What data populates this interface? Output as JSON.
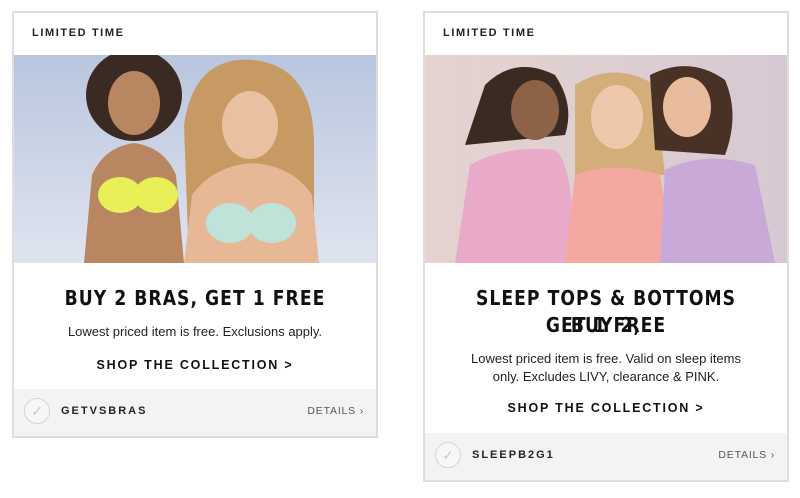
{
  "cards": [
    {
      "badge": "LIMITED TIME",
      "image_alt": "Two models wearing bras on a beach",
      "headline": "BUY 2 BRAS, GET 1 FREE",
      "description": "Lowest priced item is free. Exclusions apply.",
      "cta": "SHOP THE COLLECTION >",
      "promo_code": "GETVSBRAS",
      "details": "DETAILS ›",
      "check_icon": "✓"
    },
    {
      "badge": "LIMITED TIME",
      "image_alt": "Three models wearing sleepwear",
      "headline_line1": "SLEEP TOPS & BOTTOMS BUY 2,",
      "headline_line2": "GET 1 FREE",
      "description_line1": "Lowest priced item is free. Valid on sleep items",
      "description_line2": "only. Excludes LIVY, clearance & PINK.",
      "cta": "SHOP THE COLLECTION >",
      "promo_code": "SLEEPB2G1",
      "details": "DETAILS ›",
      "check_icon": "✓"
    }
  ]
}
